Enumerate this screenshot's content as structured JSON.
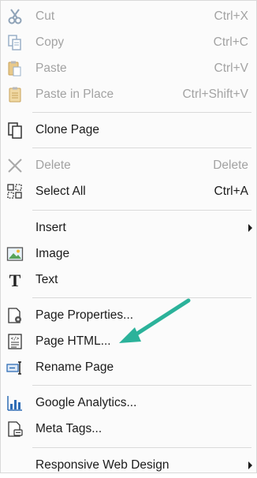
{
  "colors": {
    "annotation_arrow": "#2bb29a",
    "disabled_text": "#a3a3a3",
    "text": "#1b1b1b"
  },
  "menu": {
    "items": [
      {
        "id": "cut",
        "label": "Cut",
        "shortcut": "Ctrl+X",
        "icon": "scissors-icon",
        "disabled": true
      },
      {
        "id": "copy",
        "label": "Copy",
        "shortcut": "Ctrl+C",
        "icon": "copy-icon",
        "disabled": true
      },
      {
        "id": "paste",
        "label": "Paste",
        "shortcut": "Ctrl+V",
        "icon": "paste-icon",
        "disabled": true
      },
      {
        "id": "paste-in-place",
        "label": "Paste in Place",
        "shortcut": "Ctrl+Shift+V",
        "icon": "paste-in-place-icon",
        "disabled": true
      },
      {
        "id": "clone-page",
        "label": "Clone Page",
        "shortcut": "",
        "icon": "clone-icon",
        "disabled": false
      },
      {
        "id": "delete",
        "label": "Delete",
        "shortcut": "Delete",
        "icon": "delete-x-icon",
        "disabled": true
      },
      {
        "id": "select-all",
        "label": "Select All",
        "shortcut": "Ctrl+A",
        "icon": "select-all-icon",
        "disabled": false
      },
      {
        "id": "insert",
        "label": "Insert",
        "shortcut": "",
        "icon": "",
        "disabled": false,
        "submenu": true
      },
      {
        "id": "image",
        "label": "Image",
        "shortcut": "",
        "icon": "image-icon",
        "disabled": false
      },
      {
        "id": "text",
        "label": "Text",
        "shortcut": "",
        "icon": "text-t-icon",
        "disabled": false
      },
      {
        "id": "page-properties",
        "label": "Page Properties...",
        "shortcut": "",
        "icon": "page-properties-icon",
        "disabled": false
      },
      {
        "id": "page-html",
        "label": "Page HTML...",
        "shortcut": "",
        "icon": "page-html-icon",
        "disabled": false
      },
      {
        "id": "rename-page",
        "label": "Rename Page",
        "shortcut": "",
        "icon": "rename-icon",
        "disabled": false
      },
      {
        "id": "google-analytics",
        "label": "Google Analytics...",
        "shortcut": "",
        "icon": "analytics-chart-icon",
        "disabled": false
      },
      {
        "id": "meta-tags",
        "label": "Meta Tags...",
        "shortcut": "",
        "icon": "meta-tags-icon",
        "disabled": false
      },
      {
        "id": "responsive-web-design",
        "label": "Responsive Web Design",
        "shortcut": "",
        "icon": "",
        "disabled": false,
        "submenu": true
      }
    ]
  }
}
